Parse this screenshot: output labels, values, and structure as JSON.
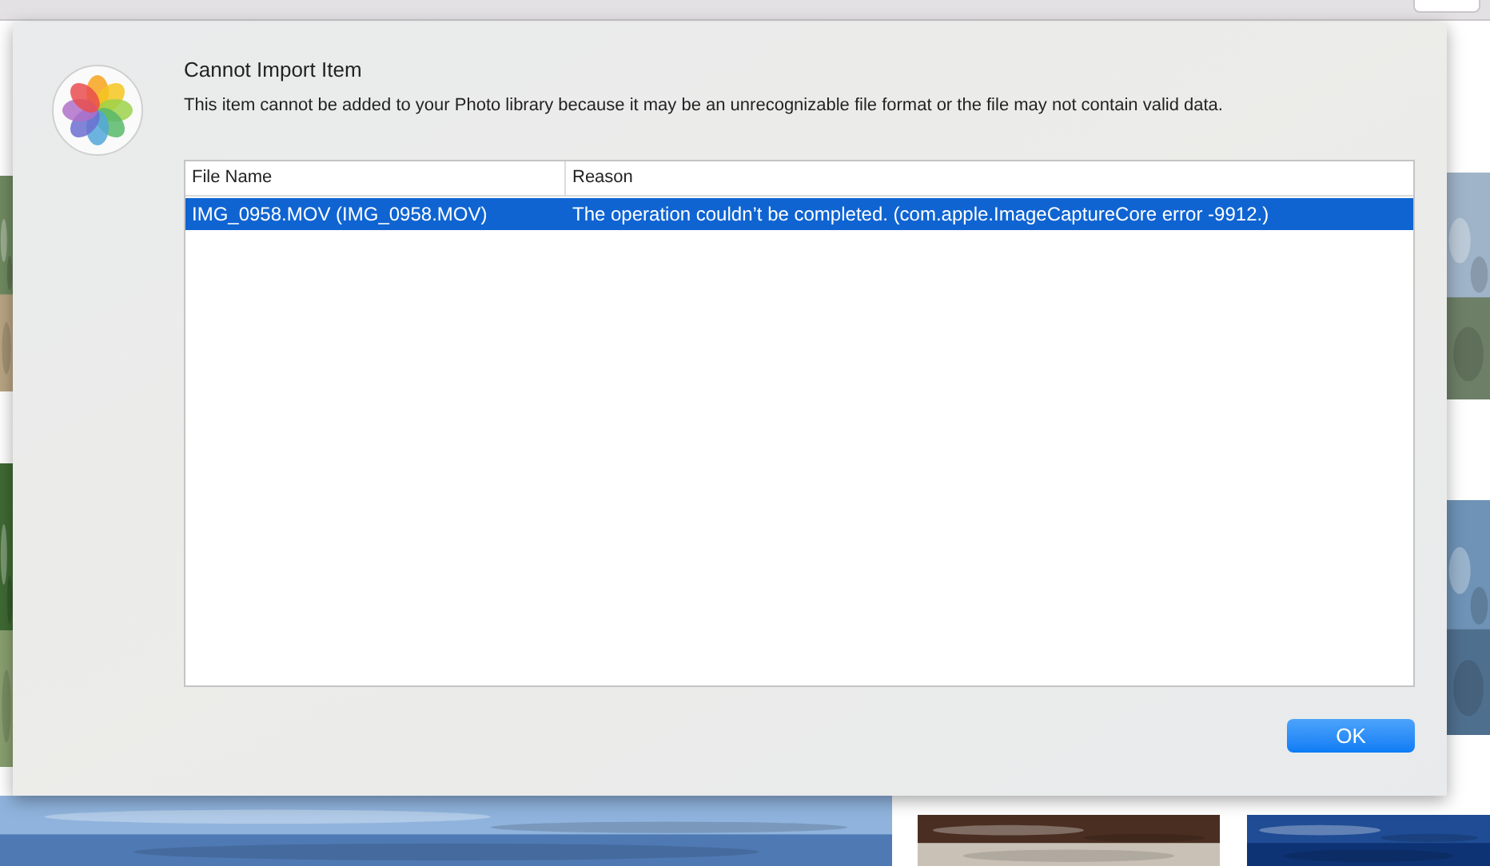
{
  "dialog": {
    "title": "Cannot Import Item",
    "message": "This item cannot be added to your Photo library because it may be an unrecognizable file format or the file may not contain valid data.",
    "table": {
      "columns": [
        "File Name",
        "Reason"
      ],
      "rows": [
        {
          "cells": [
            "IMG_0958.MOV (IMG_0958.MOV)",
            "The operation couldn’t be completed. (com.apple.ImageCaptureCore error -9912.)"
          ],
          "selected": true
        }
      ]
    },
    "buttons": [
      {
        "label": "OK",
        "default": true
      }
    ]
  }
}
